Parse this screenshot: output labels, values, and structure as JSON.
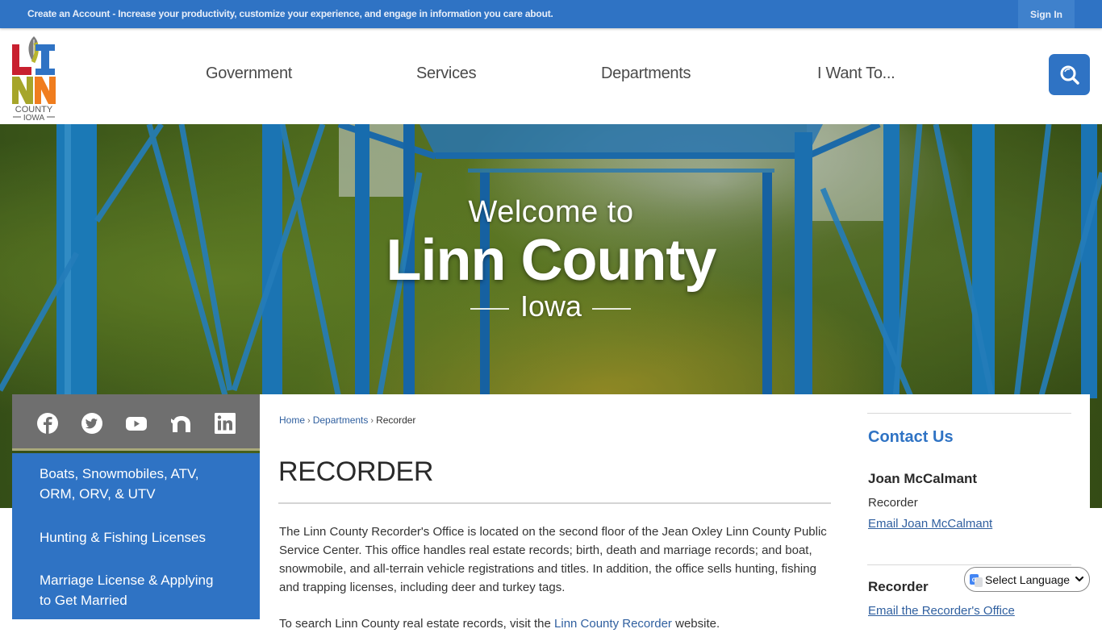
{
  "topbar": {
    "promo_text": "Create an Account - Increase your productivity, customize your experience, and engage in information you care about.",
    "signin_label": "Sign In"
  },
  "header": {
    "logo": {
      "letters": [
        "L",
        "I",
        "N",
        "N"
      ],
      "county": "COUNTY",
      "state": "IOWA",
      "colors": {
        "L": "#c8202f",
        "I": "#2f73c4",
        "N1": "#a6a52a",
        "N2": "#f07d1e"
      }
    },
    "nav": [
      {
        "label": "Government"
      },
      {
        "label": "Services"
      },
      {
        "label": "Departments"
      },
      {
        "label": "I Want To..."
      }
    ],
    "search_icon": "search-icon"
  },
  "hero": {
    "welcome": "Welcome to",
    "title": "Linn County",
    "subtitle": "Iowa"
  },
  "social": [
    {
      "name": "facebook-icon"
    },
    {
      "name": "twitter-icon"
    },
    {
      "name": "youtube-icon"
    },
    {
      "name": "nextdoor-icon"
    },
    {
      "name": "linkedin-icon"
    }
  ],
  "sidebar": {
    "items": [
      {
        "line1": "Boats, Snowmobiles, ATV,",
        "line2": "ORM, ORV, & UTV"
      },
      {
        "line1": "Hunting & Fishing Licenses",
        "line2": ""
      },
      {
        "line1": "Marriage License & Applying",
        "line2": "to Get Married"
      }
    ]
  },
  "breadcrumb": {
    "items": [
      "Home",
      "Departments"
    ],
    "current": "Recorder",
    "separator": "›"
  },
  "main": {
    "title": "RECORDER",
    "paragraph1": "The Linn County Recorder's Office is located on the second floor of the Jean Oxley Linn County Public Service Center. This office handles real estate records; birth, death and marriage records; and boat, snowmobile, and all-terrain vehicle registrations and titles. In addition, the office sells hunting, fishing and trapping licenses, including deer and turkey tags.",
    "paragraph2_start": "To search Linn County real estate records, visit the ",
    "paragraph2_link": "Linn County Recorder",
    "paragraph2_end": " website."
  },
  "contact": {
    "heading": "Contact Us",
    "person_name": "Joan McCalmant",
    "person_role": "Recorder",
    "person_email_link": "Email Joan McCalmant",
    "office_heading": "Recorder",
    "office_email_link": "Email the Recorder's Office"
  },
  "language_select": {
    "selected": "Select Language"
  },
  "colors": {
    "brand_blue": "#2f73c4",
    "link_blue": "#2f5f9f",
    "social_bar": "#6f6f6f"
  }
}
